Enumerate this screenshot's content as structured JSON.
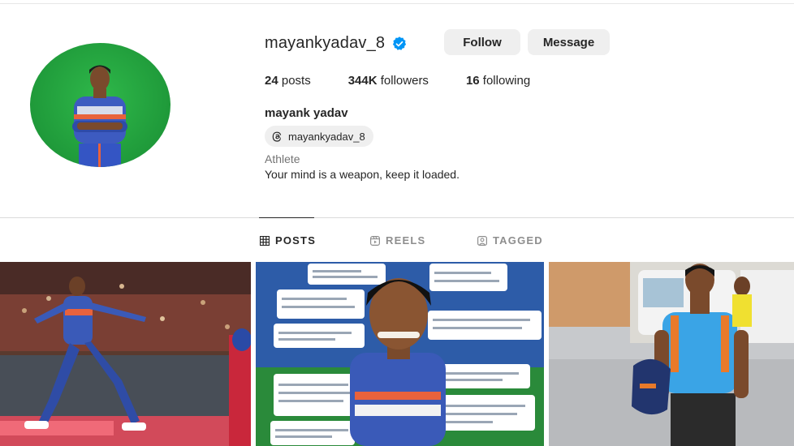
{
  "profile": {
    "username": "mayankyadav_8",
    "verified_icon": "verified-badge-icon",
    "full_name": "mayank yadav",
    "threads_handle": "mayankyadav_8",
    "category": "Athlete",
    "bio": "Your mind is a weapon, keep it loaded."
  },
  "actions": {
    "follow_label": "Follow",
    "message_label": "Message"
  },
  "stats": {
    "posts_count": "24",
    "posts_label": "posts",
    "followers_count": "344K",
    "followers_label": "followers",
    "following_count": "16",
    "following_label": "following"
  },
  "tabs": [
    {
      "label": "POSTS",
      "icon": "grid-icon",
      "active": true
    },
    {
      "label": "REELS",
      "icon": "reels-icon",
      "active": false
    },
    {
      "label": "TAGGED",
      "icon": "tagged-icon",
      "active": false
    }
  ],
  "colors": {
    "verified_blue": "#0095f6",
    "button_bg": "#efefef",
    "avatar_green": "#1f9a3a",
    "text_secondary": "#737373"
  }
}
